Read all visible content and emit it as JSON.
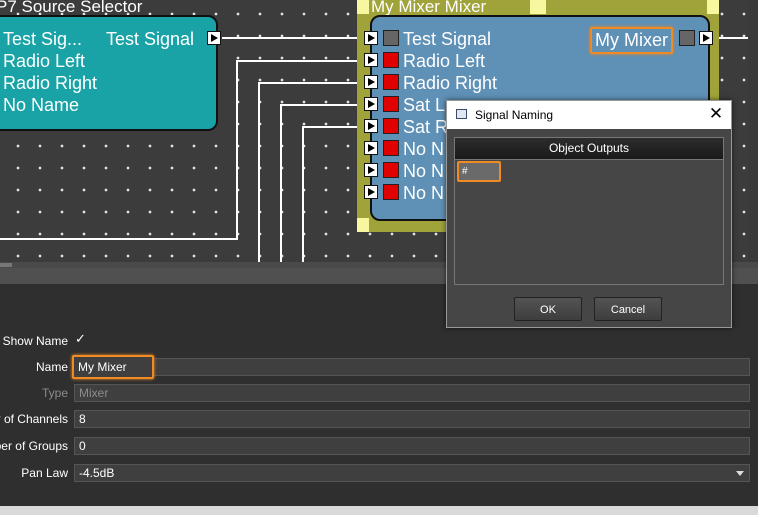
{
  "source_block": {
    "title": "P7  Source Selector",
    "inputs": [
      "Test Sig...",
      "Radio Left",
      "Radio Right",
      "No Name"
    ],
    "output_label": "Test Signal"
  },
  "mixer_block": {
    "title": "My Mixer  Mixer",
    "channels": [
      "Test Signal",
      "Radio Left",
      "Radio Right",
      "Sat L",
      "Sat R",
      "No N",
      "No N",
      "No N"
    ],
    "output_name": "My Mixer",
    "colors": {
      "muted": "#e00000",
      "active": "#666666"
    }
  },
  "properties": {
    "show_name_label": "Show Name",
    "show_name_check": "✓",
    "name_label": "Name",
    "name_value": "My Mixer",
    "type_label": "Type",
    "type_value": "Mixer",
    "channels_label": "r of Channels",
    "channels_value": "8",
    "groups_label": "ber of Groups",
    "groups_value": "0",
    "panlaw_label": "Pan Law",
    "panlaw_value": "-4.5dB"
  },
  "dialog": {
    "title": "Signal Naming",
    "close": "✕",
    "list_header": "Object Outputs",
    "cell_value": "#",
    "ok_label": "OK",
    "cancel_label": "Cancel"
  },
  "accent_color": "#f08a24"
}
